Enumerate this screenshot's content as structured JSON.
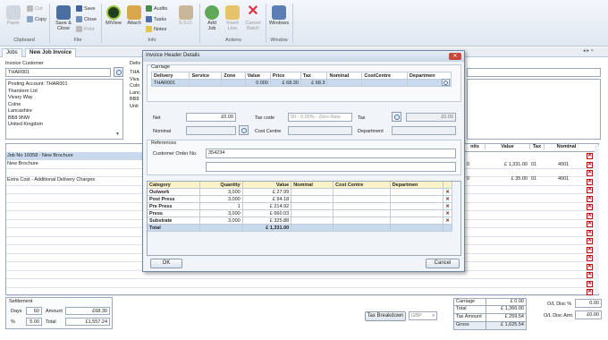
{
  "ribbon": {
    "paste": "Paste",
    "cut": "Cut",
    "copy": "Copy",
    "save_close": "Save & Close",
    "save": "Save",
    "close": "Close",
    "print": "Print",
    "miview": "MiView",
    "attach": "Attach",
    "audits": "Audits",
    "tasks": "Tasks",
    "notes": "Notes",
    "sso": "S.S.O.",
    "add_job": "Add Job",
    "insert_line": "Insert Line",
    "cancel_batch": "Cancel Batch",
    "windows": "Windows",
    "groups": [
      "Clipboard",
      "File",
      "Info",
      "Actions",
      "Window"
    ]
  },
  "tabs": [
    "Jobs",
    "New Job Invoice"
  ],
  "nav_arrows": "◂ ▸ ×",
  "left": {
    "invoice_customer_label": "Invoice Customer",
    "customer_value": "THAR001",
    "delivery_label": "Deliv",
    "address": [
      "Posting Account: THAR001",
      "Tharstern Ltd",
      "Vivary Way",
      "Colne",
      "Lancashire",
      "BB8 9NW",
      "United Kingdom"
    ],
    "addr_partial": [
      "THA",
      "Viva",
      "Coln",
      "Lanc",
      "BB8",
      "Unit"
    ]
  },
  "lines": {
    "rows": [
      "Job No 16058 : New Brochure",
      "New Brochure",
      "",
      "Extra Cost - Additional Delivery Charges"
    ]
  },
  "right_grid": {
    "headers": [
      "nits",
      "Value",
      "Tax",
      "Nominal"
    ],
    "rows": [
      {
        "units": "0",
        "value": "£ 1,331.00",
        "tax": "01",
        "nominal": "4001"
      },
      {
        "units": "0",
        "value": "£ 35.00",
        "tax": "01",
        "nominal": "4001"
      }
    ]
  },
  "settlement": {
    "title": "Settlement",
    "days_label": "Days",
    "days": "60",
    "amount_label": "Amount",
    "amount": "£68.30",
    "pct_label": "%",
    "pct": "5.00",
    "total_label": "Total",
    "total": "£1,557.24"
  },
  "footer": {
    "tax_breakdown": "Tax Breakdown",
    "currency": "GBP",
    "totals": [
      {
        "label": "Carriage",
        "value": "£ 0.00"
      },
      {
        "label": "Total",
        "value": "£ 1,366.00"
      },
      {
        "label": "Tax Amount",
        "value": "£ 259.54"
      },
      {
        "label": "Gross",
        "value": "£ 1,625.54"
      }
    ],
    "oa_disc_pct_label": "O/L Disc %",
    "oa_disc_pct": "0.00",
    "oa_disc_amt_label": "O/L Disc Amt.",
    "oa_disc_amt": "£0.00"
  },
  "dialog": {
    "title": "Invoice Header Details",
    "carriage_label": "Carriage",
    "carriage_headers": [
      "Delivery",
      "Service",
      "Zone",
      "Value",
      "Price",
      "Tax",
      "Nominal",
      "CostCentre",
      "Departmen"
    ],
    "carriage_row": [
      "THAR001",
      "",
      "",
      "0.000",
      "£ 68.30",
      "£ 68.3",
      "",
      "",
      ""
    ],
    "net_label": "Net",
    "net": "£0.00",
    "tax_code_label": "Tax code",
    "tax_code": "00 - 0.00% - Zero Rate",
    "tax_label": "Tax",
    "tax": "£0.00",
    "nominal_label": "Nominal",
    "cost_centre_label": "Cost Centre",
    "department_label": "Department",
    "references_label": "References",
    "customer_order_label": "Customer Order No.",
    "customer_order": "354234",
    "table_headers": [
      "Category",
      "Quantity",
      "Value",
      "Nominal",
      "Cost Centre",
      "Departmen"
    ],
    "table_rows": [
      {
        "category": "Outwork",
        "qty": "3,000",
        "value": "27.99"
      },
      {
        "category": "Post Press",
        "qty": "3,000",
        "value": "94.18"
      },
      {
        "category": "Pre Press",
        "qty": "1",
        "value": "214.92"
      },
      {
        "category": "Press",
        "qty": "3,000",
        "value": "660.03"
      },
      {
        "category": "Substrate",
        "qty": "3,000",
        "value": "325.88"
      }
    ],
    "total_label": "Total",
    "total_value": "1,331.00",
    "ok": "OK",
    "cancel": "Cancel"
  }
}
